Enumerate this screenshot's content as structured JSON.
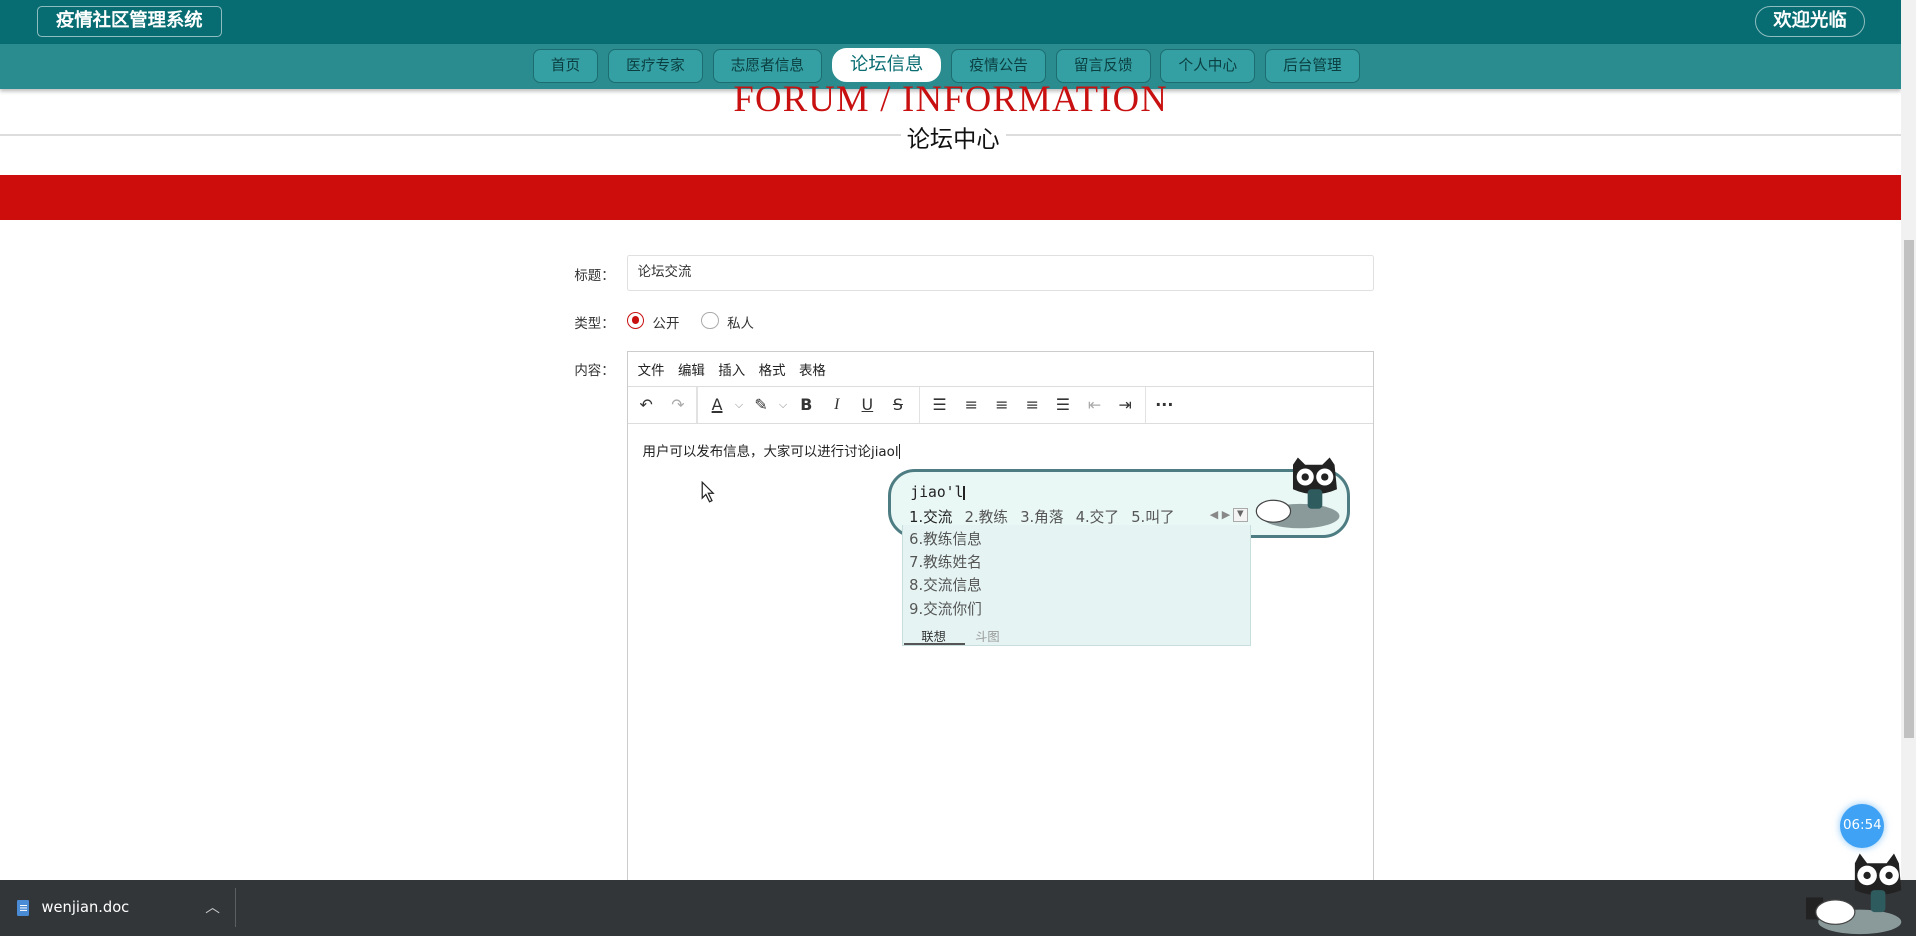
{
  "header": {
    "brand": "疫情社区管理系统",
    "welcome": "欢迎光临"
  },
  "nav": {
    "items": [
      {
        "label": "首页"
      },
      {
        "label": "医疗专家"
      },
      {
        "label": "志愿者信息"
      },
      {
        "label": "论坛信息",
        "active": true
      },
      {
        "label": "疫情公告"
      },
      {
        "label": "留言反馈"
      },
      {
        "label": "个人中心"
      },
      {
        "label": "后台管理"
      }
    ]
  },
  "page": {
    "title_en": "FORUM / INFORMATION",
    "title_cn": "论坛中心"
  },
  "form": {
    "title_label": "标题：",
    "title_value": "论坛交流",
    "type_label": "类型：",
    "type_options": [
      {
        "label": "公开",
        "checked": true
      },
      {
        "label": "私人",
        "checked": false
      }
    ],
    "content_label": "内容："
  },
  "editor": {
    "menu": [
      "文件",
      "编辑",
      "插入",
      "格式",
      "表格"
    ],
    "content": "用户可以发布信息，大家可以进行讨论jiaol"
  },
  "ime": {
    "pinyin": "jiao'l",
    "candidates": [
      "1.交流",
      "2.教练",
      "3.角落",
      "4.交了",
      "5.叫了"
    ],
    "more": [
      "6.教练信息",
      "7.教练姓名",
      "8.交流信息",
      "9.交流你们"
    ],
    "tabs": [
      "联想",
      "斗图"
    ]
  },
  "timer": "06:54",
  "download": {
    "filename": "wenjian.doc"
  },
  "colors": {
    "header": "#076d72",
    "nav": "#2a8c8f",
    "accent_red": "#cd0c0c"
  }
}
